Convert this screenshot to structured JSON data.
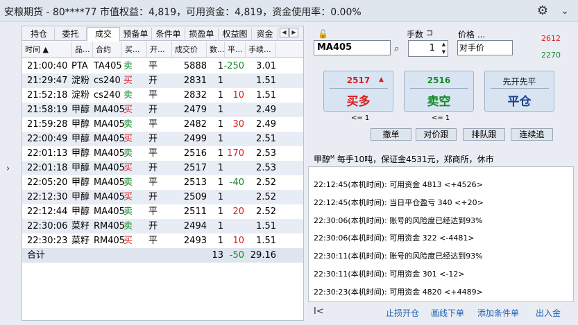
{
  "titlebar": {
    "title": "安粮期货 - 80****77 市值权益：4,819，可用资金：4,819，资金使用率：0.00%",
    "icons": [
      "gear-icon",
      "chevron-down-icon"
    ]
  },
  "tabs": [
    "持仓",
    "委托",
    "成交",
    "预备单",
    "条件单",
    "损盈单",
    "权益图",
    "资金"
  ],
  "active_tab": "成交",
  "columns": [
    "时间 ▲",
    "品...",
    "合约",
    "买...",
    "开...",
    "成交价",
    "数...",
    "平...",
    "手续..."
  ],
  "trades": [
    {
      "time": "21:00:40",
      "product": "PTA",
      "contract": "TA405",
      "side": "卖",
      "oc": "平",
      "price": "5888",
      "qty": "1",
      "pnl": "-250",
      "fee": "3.01"
    },
    {
      "time": "21:29:47",
      "product": "淀粉",
      "contract": "cs240",
      "side": "买",
      "oc": "开",
      "price": "2831",
      "qty": "1",
      "pnl": "",
      "fee": "1.51"
    },
    {
      "time": "21:52:18",
      "product": "淀粉",
      "contract": "cs240",
      "side": "卖",
      "oc": "平",
      "price": "2832",
      "qty": "1",
      "pnl": "10",
      "fee": "1.51"
    },
    {
      "time": "21:58:19",
      "product": "甲醇",
      "contract": "MA405",
      "side": "买",
      "oc": "开",
      "price": "2479",
      "qty": "1",
      "pnl": "",
      "fee": "2.49"
    },
    {
      "time": "21:59:28",
      "product": "甲醇",
      "contract": "MA405",
      "side": "卖",
      "oc": "平",
      "price": "2482",
      "qty": "1",
      "pnl": "30",
      "fee": "2.49"
    },
    {
      "time": "22:00:49",
      "product": "甲醇",
      "contract": "MA405",
      "side": "买",
      "oc": "开",
      "price": "2499",
      "qty": "1",
      "pnl": "",
      "fee": "2.51"
    },
    {
      "time": "22:01:13",
      "product": "甲醇",
      "contract": "MA405",
      "side": "卖",
      "oc": "平",
      "price": "2516",
      "qty": "1",
      "pnl": "170",
      "fee": "2.53"
    },
    {
      "time": "22:01:18",
      "product": "甲醇",
      "contract": "MA405",
      "side": "买",
      "oc": "开",
      "price": "2517",
      "qty": "1",
      "pnl": "",
      "fee": "2.53"
    },
    {
      "time": "22:05:20",
      "product": "甲醇",
      "contract": "MA405",
      "side": "卖",
      "oc": "平",
      "price": "2513",
      "qty": "1",
      "pnl": "-40",
      "fee": "2.52"
    },
    {
      "time": "22:12:30",
      "product": "甲醇",
      "contract": "MA405",
      "side": "买",
      "oc": "开",
      "price": "2509",
      "qty": "1",
      "pnl": "",
      "fee": "2.52"
    },
    {
      "time": "22:12:44",
      "product": "甲醇",
      "contract": "MA405",
      "side": "卖",
      "oc": "平",
      "price": "2511",
      "qty": "1",
      "pnl": "20",
      "fee": "2.52"
    },
    {
      "time": "22:30:06",
      "product": "菜籽",
      "contract": "RM405",
      "side": "卖",
      "oc": "开",
      "price": "2494",
      "qty": "1",
      "pnl": "",
      "fee": "1.51"
    },
    {
      "time": "22:30:23",
      "product": "菜籽",
      "contract": "RM405",
      "side": "买",
      "oc": "平",
      "price": "2493",
      "qty": "1",
      "pnl": "10",
      "fee": "1.51"
    }
  ],
  "total": {
    "label": "合计",
    "qty": "13",
    "pnl": "-50",
    "fee": "29.16"
  },
  "order": {
    "symbol": "MA405",
    "qty_label": "手数",
    "qty": "1",
    "price_label": "价格 ...",
    "price_type": "对手价",
    "ask": "2612",
    "bid": "2270",
    "buy_price": "2517",
    "buy_label": "买多",
    "sell_price": "2516",
    "sell_label": "卖空",
    "close_title": "先开先平",
    "close_label": "平仓",
    "buy_limit": "<= 1",
    "sell_limit": "<= 1",
    "buttons": [
      "撤单",
      "对价跟",
      "排队跟",
      "连续追"
    ]
  },
  "info": {
    "prefix": "甲醇",
    "mark": "M",
    "text": " 每手10吨，保证金4531元，郑商所，休市"
  },
  "log": [
    "22:12:45(本机时间): 可用资金 4813 <+4526>",
    "22:12:45(本机时间): 当日平仓盈亏 340 <+20>",
    "22:30:06(本机时间): 账号的风险度已经达到93%",
    "22:30:06(本机时间): 可用资金 322 <-4481>",
    "22:30:11(本机时间): 账号的风险度已经达到93%",
    "22:30:11(本机时间): 可用资金 301 <-12>",
    "22:30:23(本机时间): 可用资金 4820 <+4489>"
  ],
  "bottom": {
    "nav": "I<",
    "links": [
      "止损开仓",
      "画线下单",
      "添加条件单",
      "出入金"
    ]
  },
  "colors": {
    "buy": "#d81e1e",
    "sell": "#148a2a",
    "close": "#1b3e8f"
  }
}
